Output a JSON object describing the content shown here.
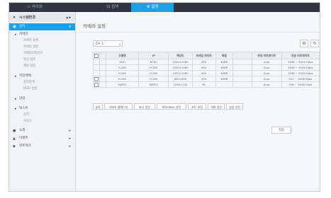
{
  "topbar": {
    "tabs": [
      {
        "label": "▭ 라이브",
        "active": false
      },
      {
        "label": "Q 검색",
        "active": false
      },
      {
        "label": "⚙ 설정",
        "active": true
      }
    ]
  },
  "sidebar": {
    "header": {
      "label": "시스템환경",
      "icon": "gear-icon"
    },
    "items": [
      {
        "label": "장치",
        "active": true
      },
      {
        "label": "카메라",
        "sub": false
      },
      {
        "label": "카메라 등록",
        "sub": true
      },
      {
        "label": "카메라 설정",
        "sub": true
      },
      {
        "label": "카메라비밀번호",
        "sub": true
      },
      {
        "label": "영상 설정",
        "sub": true
      },
      {
        "label": "채널 설정",
        "sub": true
      },
      {
        "label": "저장매체",
        "sub": false
      },
      {
        "label": "장치검색",
        "sub": true
      },
      {
        "label": "HDD 설정",
        "sub": true
      },
      {
        "label": "알람",
        "sub": false
      },
      {
        "label": "텍스트",
        "sub": false
      },
      {
        "label": "장치",
        "sub": true
      },
      {
        "label": "사용자",
        "sub": true
      },
      {
        "label": "녹화",
        "icon": "record-icon"
      },
      {
        "label": "이벤트",
        "icon": "event-icon"
      },
      {
        "label": "네트워크",
        "icon": "network-icon"
      }
    ]
  },
  "page": {
    "title": "카메라 설정",
    "select_value": "CH 1",
    "table": {
      "headers": [
        "",
        "",
        "모델명",
        "IP",
        "해상도",
        "프레임 레이트",
        "화질",
        "",
        "최대 비트레이트",
        "전송 비트레이트"
      ],
      "rows": [
        [
          "",
          "",
          "XNO",
          "NTSC",
          "1920×1080",
          "30",
          "VBR",
          "",
          "Auto",
          "2048 ~ 8192 Kbps"
        ],
        [
          "",
          "",
          "H.265",
          "H.265",
          "1920×1080",
          "30",
          "VBR",
          "",
          "Auto",
          "2048 ~ 8192 Kbps"
        ],
        [
          "",
          "",
          "H.265",
          "H.265",
          "1920×1080",
          "30",
          "VBR",
          "",
          "Auto",
          "2048 ~ 8192 Kbps"
        ],
        [
          "",
          "",
          "H.265",
          "H.265",
          "800×600",
          "30",
          "VBR",
          "",
          "Auto",
          "512 ~ 4096 Kbps"
        ],
        [
          "",
          "",
          "MJPEG",
          "MJPEG",
          "1280×720",
          "5",
          "",
          "",
          "Auto",
          "256 ~ 2048 Kbps"
        ]
      ]
    },
    "buttons": [
      "설정",
      "카메라 웹페이지",
      "표시 설정",
      "Windows 설정",
      "포트 설정",
      "개별 설정",
      "일괄 설정"
    ],
    "apply_label": "적용"
  }
}
